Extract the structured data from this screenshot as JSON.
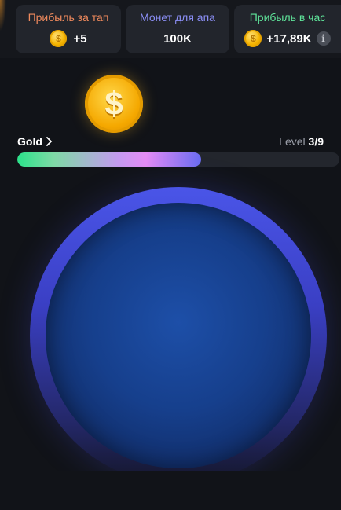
{
  "stats": [
    {
      "title": "Прибыль за тап",
      "title_color": "#f08a5d",
      "value": "+5",
      "icon": "coin-icon"
    },
    {
      "title": "Монет для апа",
      "title_color": "#8b8ef5",
      "value": "100K"
    },
    {
      "title": "Прибыль в час",
      "title_color": "#5fe49a",
      "value": "+17,89K",
      "icon": "coin-icon",
      "extra_icon": "info-icon"
    }
  ],
  "coin_symbol": "$",
  "level": {
    "name": "Gold",
    "label": "Level",
    "current": "3/9",
    "progress": 0.57
  },
  "colors": {
    "background": "#111318",
    "card": "#22252c",
    "coin": "#f5b400",
    "tap_ring": "#4a55e8"
  }
}
